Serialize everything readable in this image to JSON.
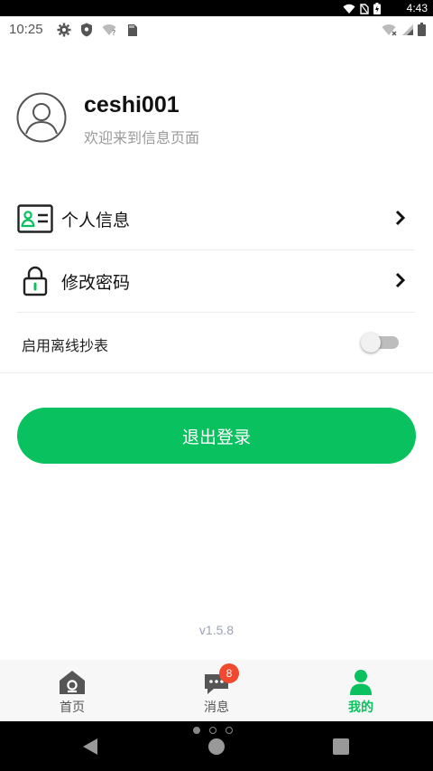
{
  "system": {
    "time_right": "4:43"
  },
  "status": {
    "clock": "10:25"
  },
  "profile": {
    "username": "ceshi001",
    "welcome": "欢迎来到信息页面"
  },
  "menu": [
    {
      "label": "个人信息",
      "icon": "id-card-icon"
    },
    {
      "label": "修改密码",
      "icon": "padlock-icon"
    }
  ],
  "offline": {
    "label": "启用离线抄表",
    "enabled": false
  },
  "logout": {
    "label": "退出登录"
  },
  "version": "v1.5.8",
  "tabs": [
    {
      "label": "首页",
      "icon": "home-icon"
    },
    {
      "label": "消息",
      "icon": "chat-icon",
      "badge": "8"
    },
    {
      "label": "我的",
      "icon": "person-icon",
      "active": true
    }
  ],
  "colors": {
    "accent": "#0ac15f",
    "badge": "#f0492f"
  }
}
